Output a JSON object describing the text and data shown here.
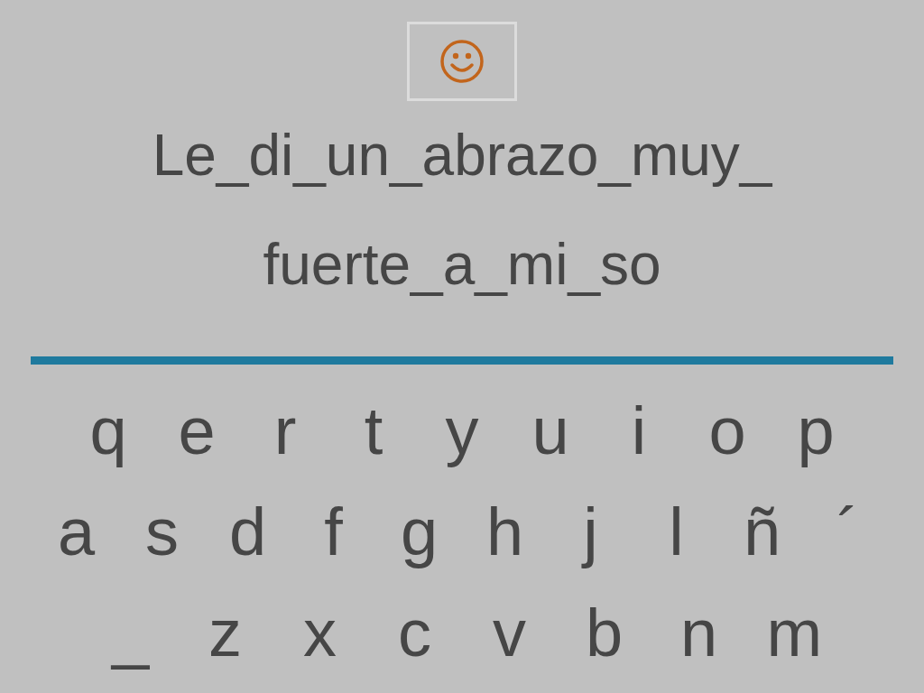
{
  "sentence": {
    "lines": [
      "Le_di_un_abrazo_muy_",
      "fuerte_a_mi_so"
    ]
  },
  "keyboard": {
    "rows": [
      [
        "q",
        "e",
        "r",
        "t",
        "y",
        "u",
        "i",
        "o",
        "p"
      ],
      [
        "a",
        "s",
        "d",
        "f",
        "g",
        "h",
        "j",
        "l",
        "ñ",
        "´"
      ],
      [
        "_",
        "z",
        "x",
        "c",
        "v",
        "b",
        "n",
        "m"
      ]
    ]
  }
}
